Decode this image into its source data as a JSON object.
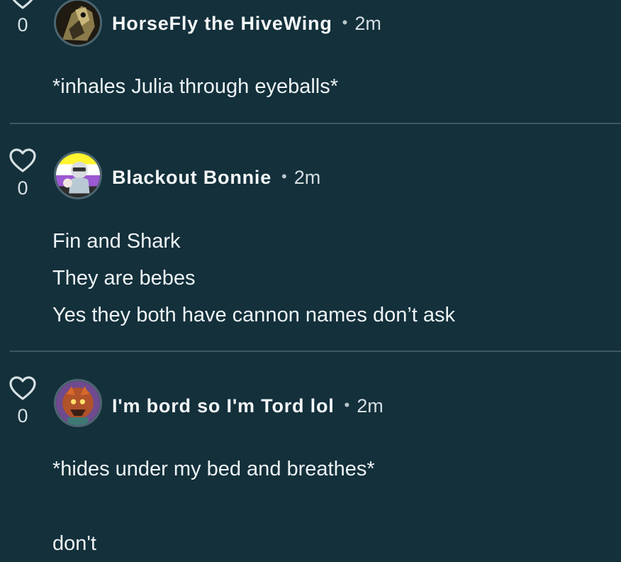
{
  "comments": [
    {
      "author": "HorseFly the HiveWing",
      "time": "2m",
      "likes": "0",
      "lines": [
        "*inhales Julia through eyeballs*"
      ]
    },
    {
      "author": "Blackout Bonnie",
      "time": "2m",
      "likes": "0",
      "lines": [
        "Fin and Shark",
        "They are bebes",
        "Yes they both have cannon names don’t ask"
      ]
    },
    {
      "author": "I'm bord so I'm Tord lol",
      "time": "2m",
      "likes": "0",
      "lines": [
        "*hides under my bed and breathes*",
        "don't"
      ]
    }
  ],
  "separator": "•",
  "icons": {
    "like": "heart-outline-icon"
  },
  "colors": {
    "background": "#13303b",
    "divider": "#3d5762",
    "text": "#eef3f5"
  }
}
